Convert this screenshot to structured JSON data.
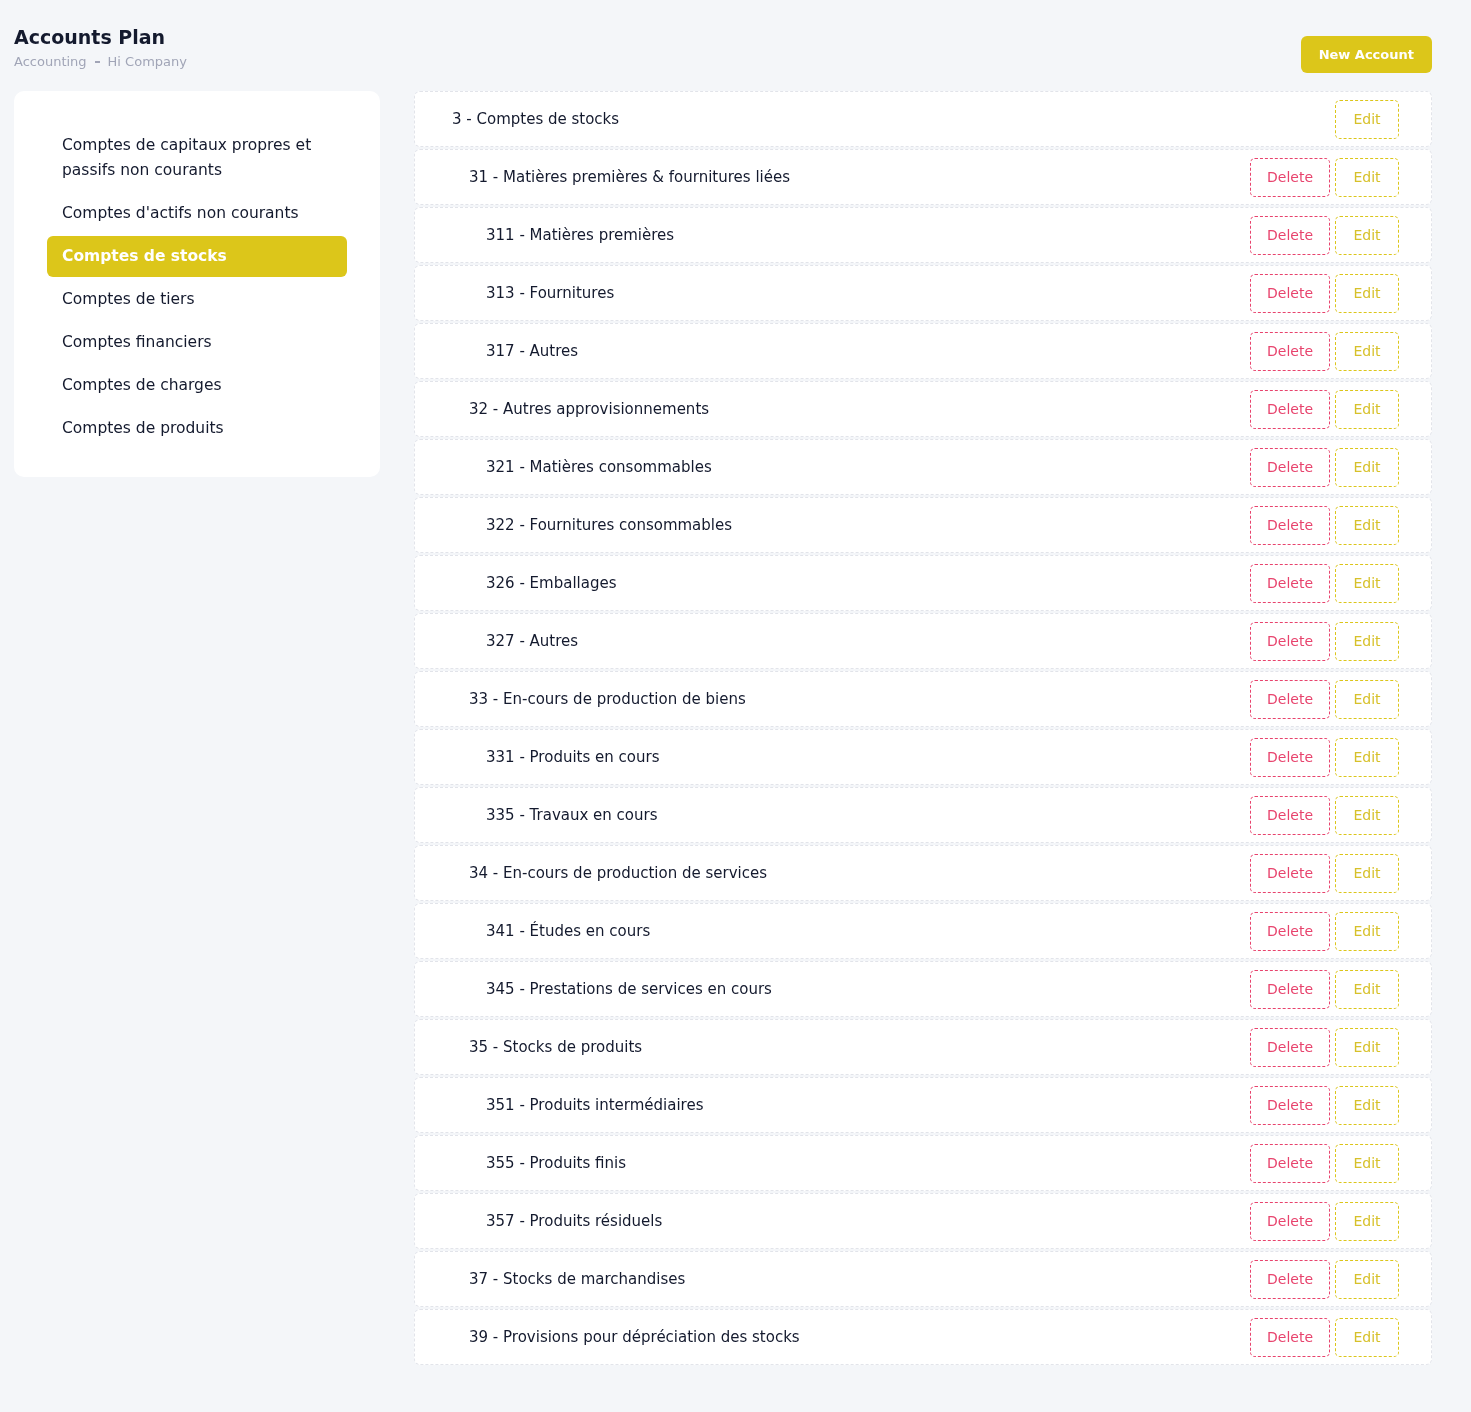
{
  "header": {
    "title": "Accounts Plan",
    "breadcrumb": [
      "Accounting",
      "Hi Company"
    ],
    "new_button": "New Account"
  },
  "sidebar": {
    "items": [
      {
        "label": "Comptes de capitaux propres et passifs non courants",
        "selected": false
      },
      {
        "label": "Comptes d'actifs non courants",
        "selected": false
      },
      {
        "label": "Comptes de stocks",
        "selected": true
      },
      {
        "label": "Comptes de tiers",
        "selected": false
      },
      {
        "label": "Comptes financiers",
        "selected": false
      },
      {
        "label": "Comptes de charges",
        "selected": false
      },
      {
        "label": "Comptes de produits",
        "selected": false
      }
    ]
  },
  "accounts": [
    {
      "label": "3 - Comptes de stocks",
      "edit": "Edit",
      "children": [
        {
          "label": "31 - Matières premières & fournitures liées",
          "delete": "Delete",
          "edit": "Edit",
          "children": [
            {
              "label": "311 - Matières premières",
              "delete": "Delete",
              "edit": "Edit"
            },
            {
              "label": "313 - Fournitures",
              "delete": "Delete",
              "edit": "Edit"
            },
            {
              "label": "317 - Autres",
              "delete": "Delete",
              "edit": "Edit"
            }
          ]
        },
        {
          "label": "32 - Autres approvisionnements",
          "delete": "Delete",
          "edit": "Edit",
          "children": [
            {
              "label": "321 - Matières consommables",
              "delete": "Delete",
              "edit": "Edit"
            },
            {
              "label": "322 - Fournitures consommables",
              "delete": "Delete",
              "edit": "Edit"
            },
            {
              "label": "326 - Emballages",
              "delete": "Delete",
              "edit": "Edit"
            },
            {
              "label": "327 - Autres",
              "delete": "Delete",
              "edit": "Edit"
            }
          ]
        },
        {
          "label": "33 - En-cours de production de biens",
          "delete": "Delete",
          "edit": "Edit",
          "children": [
            {
              "label": "331 - Produits en cours",
              "delete": "Delete",
              "edit": "Edit"
            },
            {
              "label": "335 - Travaux en cours",
              "delete": "Delete",
              "edit": "Edit"
            }
          ]
        },
        {
          "label": "34 - En-cours de production de services",
          "delete": "Delete",
          "edit": "Edit",
          "children": [
            {
              "label": "341 - Études en cours",
              "delete": "Delete",
              "edit": "Edit"
            },
            {
              "label": "345 - Prestations de services en cours",
              "delete": "Delete",
              "edit": "Edit"
            }
          ]
        },
        {
          "label": "35 - Stocks de produits",
          "delete": "Delete",
          "edit": "Edit",
          "children": [
            {
              "label": "351 - Produits intermédiaires",
              "delete": "Delete",
              "edit": "Edit"
            },
            {
              "label": "355 - Produits finis",
              "delete": "Delete",
              "edit": "Edit"
            },
            {
              "label": "357 - Produits résiduels",
              "delete": "Delete",
              "edit": "Edit"
            }
          ]
        },
        {
          "label": "37 - Stocks de marchandises",
          "delete": "Delete",
          "edit": "Edit"
        },
        {
          "label": "39 - Provisions pour dépréciation des stocks",
          "delete": "Delete",
          "edit": "Edit"
        }
      ]
    }
  ]
}
